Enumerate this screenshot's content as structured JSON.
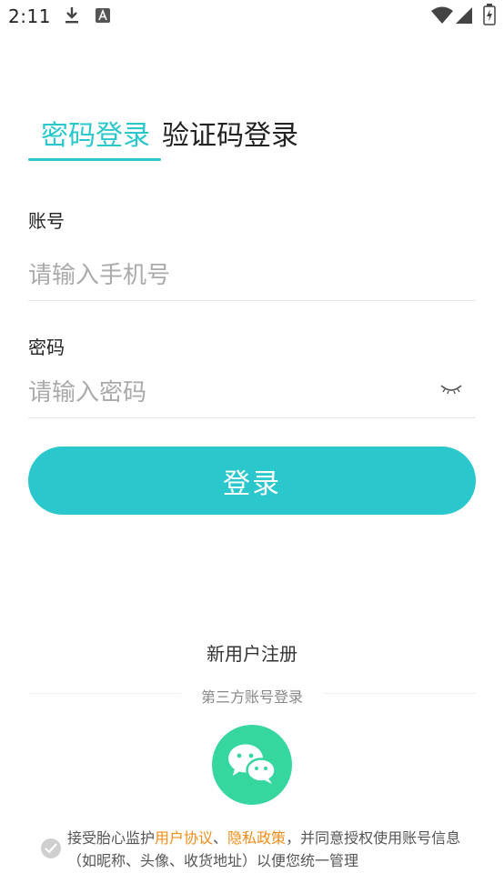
{
  "status_bar": {
    "time": "2:11",
    "icons": [
      "download-icon",
      "a-icon",
      "wifi-icon",
      "signal-icon",
      "battery-icon"
    ]
  },
  "tabs": {
    "password_login": "密码登录",
    "code_login": "验证码登录",
    "active": "password_login"
  },
  "account": {
    "label": "账号",
    "placeholder": "请输入手机号",
    "value": ""
  },
  "password": {
    "label": "密码",
    "placeholder": "请输入密码",
    "value": "",
    "toggle_icon": "eye-closed-icon"
  },
  "login_button": "登录",
  "register_link": "新用户注册",
  "third_party": {
    "title": "第三方账号登录",
    "providers": [
      "wechat"
    ]
  },
  "agreement": {
    "prefix": "接受胎心监护",
    "user_agreement": "用户协议",
    "separator": "、",
    "privacy_policy": "隐私政策",
    "suffix": "，并同意授权使用账号信息（如昵称、头像、收货地址）以便您统一管理",
    "checked": true
  },
  "colors": {
    "accent": "#2ac7cc",
    "link": "#f08c18",
    "wechat": "#36d69f"
  }
}
